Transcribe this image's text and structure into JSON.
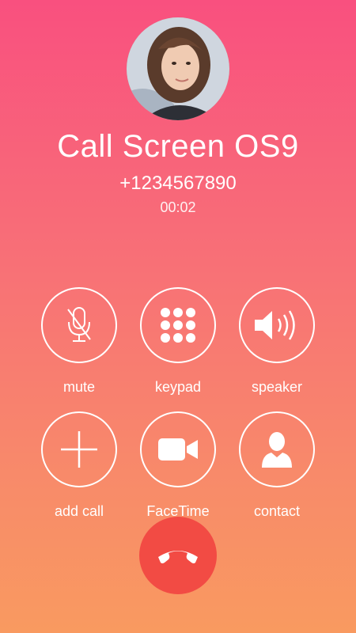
{
  "caller": {
    "name": "Call Screen OS9",
    "number": "+1234567890",
    "duration": "00:02"
  },
  "controls": [
    {
      "label": "mute",
      "icon": "mic-off-icon"
    },
    {
      "label": "keypad",
      "icon": "keypad-icon"
    },
    {
      "label": "speaker",
      "icon": "speaker-icon"
    },
    {
      "label": "add call",
      "icon": "plus-icon"
    },
    {
      "label": "FaceTime",
      "icon": "video-camera-icon"
    },
    {
      "label": "contact",
      "icon": "person-icon"
    }
  ],
  "end_call": {
    "icon": "phone-hangup-icon",
    "color": "#f24b44"
  },
  "colors": {
    "gradient_top": "#f9507f",
    "gradient_bottom": "#f99a60"
  }
}
